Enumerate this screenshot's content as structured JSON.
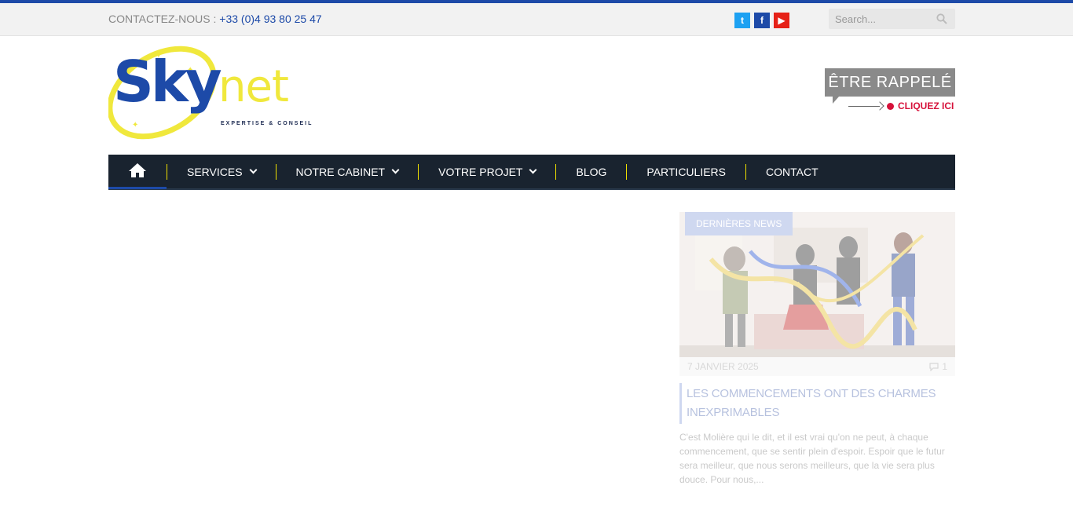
{
  "topbar": {
    "contact_label": "CONTACTEZ-NOUS : ",
    "phone": "+33 (0)4 93 80 25 47",
    "social": [
      "twitter-icon",
      "facebook-icon",
      "youtube-icon"
    ],
    "search_placeholder": "Search..."
  },
  "logo": {
    "sky": "Sky",
    "net": "net",
    "tagline": "EXPERTISE & CONSEIL"
  },
  "callback": {
    "title": "ÊTRE RAPPELÉ",
    "link": "CLIQUEZ ICI"
  },
  "nav": {
    "items": [
      {
        "label": "SERVICES",
        "has_dropdown": true
      },
      {
        "label": "NOTRE CABINET",
        "has_dropdown": true
      },
      {
        "label": "VOTRE PROJET",
        "has_dropdown": true
      },
      {
        "label": "BLOG",
        "has_dropdown": false
      },
      {
        "label": "PARTICULIERS",
        "has_dropdown": false
      },
      {
        "label": "CONTACT",
        "has_dropdown": false
      }
    ]
  },
  "news": {
    "badge": "DERNIÈRES NEWS",
    "date": "7 JANVIER 2025",
    "comments": "1",
    "title": "LES COMMENCEMENTS ONT DES CHARMES INEXPRIMABLES",
    "excerpt": "C'est Molière qui le dit, et il est vrai qu'on ne peut, à chaque commencement, que se sentir plein d'espoir. Espoir que le futur sera meilleur, que nous serons meilleurs, que la vie sera plus douce.   Pour nous,..."
  },
  "colors": {
    "brand_blue": "#1d4aa8",
    "brand_yellow": "#f0e83c",
    "nav_bg": "#19232f",
    "accent_red": "#d6113a"
  }
}
